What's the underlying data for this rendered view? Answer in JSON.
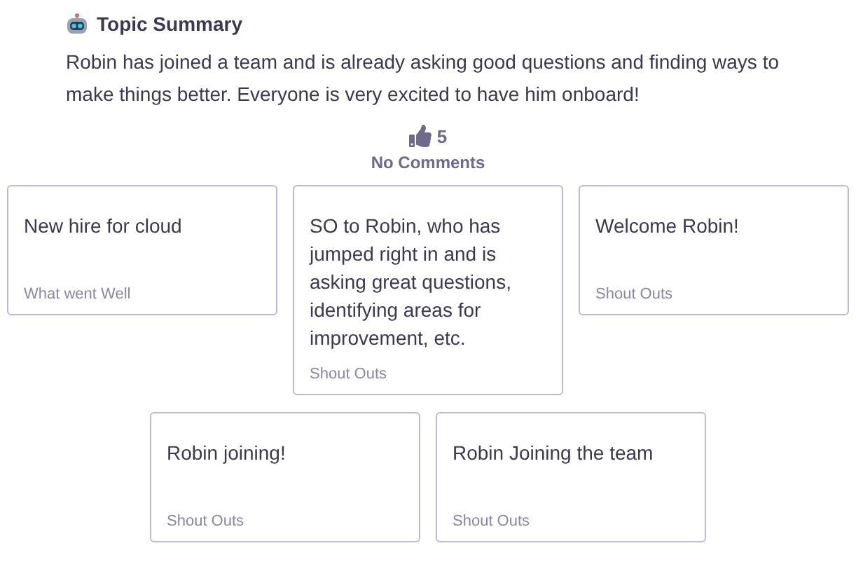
{
  "summary": {
    "title": "Topic Summary",
    "text": "Robin has joined a team and is already asking good questions and finding ways to make things better. Everyone is very excited to have him onboard!"
  },
  "reactions": {
    "likes": "5",
    "comments": "No Comments"
  },
  "cards": [
    {
      "text": "New hire for cloud",
      "category": "What went Well"
    },
    {
      "text": "SO to Robin, who has jumped right in and is asking great questions, identifying areas for improvement, etc.",
      "category": "Shout Outs"
    },
    {
      "text": "Welcome Robin!",
      "category": "Shout Outs"
    },
    {
      "text": "Robin joining!",
      "category": "Shout Outs"
    },
    {
      "text": "Robin Joining the team",
      "category": "Shout Outs"
    }
  ]
}
